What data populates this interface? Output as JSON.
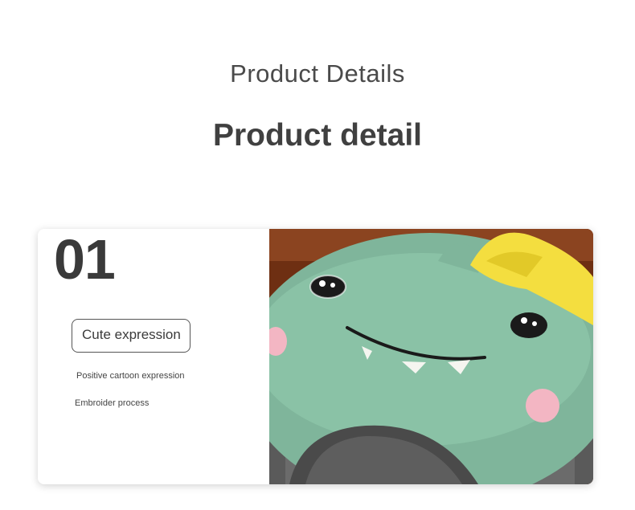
{
  "header": {
    "title": "Product Details",
    "subtitle": "Product detail"
  },
  "feature": {
    "number": "01",
    "label": "Cute expression",
    "points": [
      "Positive cartoon expression",
      "Embroider process"
    ]
  },
  "image": {
    "subject": "green-dinosaur-neck-pillow",
    "colors": {
      "plush": "#7fb59b",
      "horn": "#f4de3f",
      "background": "#7a3a1c"
    }
  }
}
